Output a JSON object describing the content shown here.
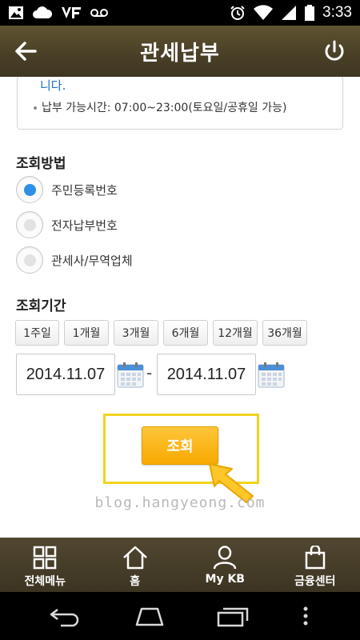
{
  "status_bar": {
    "time": "3:33"
  },
  "header": {
    "title": "관세납부"
  },
  "notice": {
    "continuation": "니다.",
    "item": "납부 가능시간: 07:00~23:00(토요일/공휴일 가능)"
  },
  "search_method": {
    "title": "조회방법",
    "options": [
      {
        "label": "주민등록번호",
        "selected": true
      },
      {
        "label": "전자납부번호",
        "selected": false
      },
      {
        "label": "관세사/무역업체",
        "selected": false
      }
    ]
  },
  "period": {
    "title": "조회기간",
    "buttons": [
      "1주일",
      "1개월",
      "3개월",
      "6개월",
      "12개월",
      "36개월"
    ],
    "start_date": "2014.11.07",
    "separator": "-",
    "end_date": "2014.11.07"
  },
  "search_button": {
    "label": "조회"
  },
  "watermark": "blog.hangyeong.com",
  "tab_bar": {
    "items": [
      {
        "label": "전체메뉴",
        "icon": "grid-menu-icon"
      },
      {
        "label": "홈",
        "icon": "home-icon"
      },
      {
        "label": "My KB",
        "icon": "person-icon"
      },
      {
        "label": "금융센터",
        "icon": "shopping-bag-icon"
      }
    ]
  },
  "colors": {
    "header_bg": "#4a4027",
    "accent_yellow": "#f7a900",
    "highlight_border": "#f2d31d",
    "radio_selected": "#2b8fe6",
    "notice_text": "#1a6fc7"
  }
}
